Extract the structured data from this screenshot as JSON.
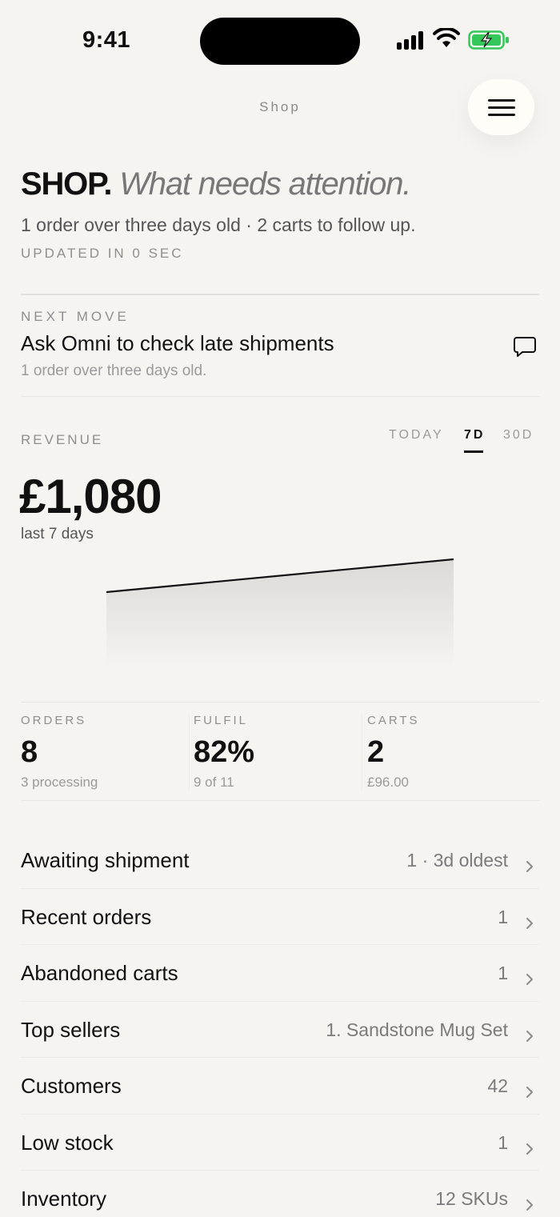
{
  "status_bar": {
    "time": "9:41"
  },
  "header": {
    "title": "Shop"
  },
  "hero": {
    "title_bold": "SHOP.",
    "title_italic": "What needs attention.",
    "subtitle": "1 order over three days old · 2 carts to follow up.",
    "updated": "UPDATED IN 0 SEC"
  },
  "next_move": {
    "eyebrow": "NEXT MOVE",
    "title": "Ask Omni to check late shipments",
    "subtitle": "1 order over three days old."
  },
  "revenue": {
    "label": "REVENUE",
    "value": "£1,080",
    "period": "last 7 days",
    "tabs": [
      "TODAY",
      "7D",
      "30D"
    ],
    "active_tab": "7D"
  },
  "stats": [
    {
      "label": "ORDERS",
      "value": "8",
      "sub": "3 processing"
    },
    {
      "label": "FULFIL",
      "value": "82%",
      "sub": "9 of 11"
    },
    {
      "label": "CARTS",
      "value": "2",
      "sub": "£96.00"
    }
  ],
  "list": [
    {
      "label": "Awaiting shipment",
      "value": "1 · 3d oldest"
    },
    {
      "label": "Recent orders",
      "value": "1"
    },
    {
      "label": "Abandoned carts",
      "value": "1"
    },
    {
      "label": "Top sellers",
      "value": "1. Sandstone Mug Set"
    },
    {
      "label": "Customers",
      "value": "42"
    },
    {
      "label": "Low stock",
      "value": "1"
    },
    {
      "label": "Inventory",
      "value": "12 SKUs"
    }
  ],
  "colors": {
    "background": "#f5f4f1",
    "text": "#111111",
    "muted": "#8e8e8e",
    "battery_fill": "#34c759"
  },
  "icons": [
    "menu-icon",
    "chat-bubble-icon",
    "chevron-right-icon",
    "signal-icon",
    "wifi-icon",
    "battery-charging-icon"
  ]
}
